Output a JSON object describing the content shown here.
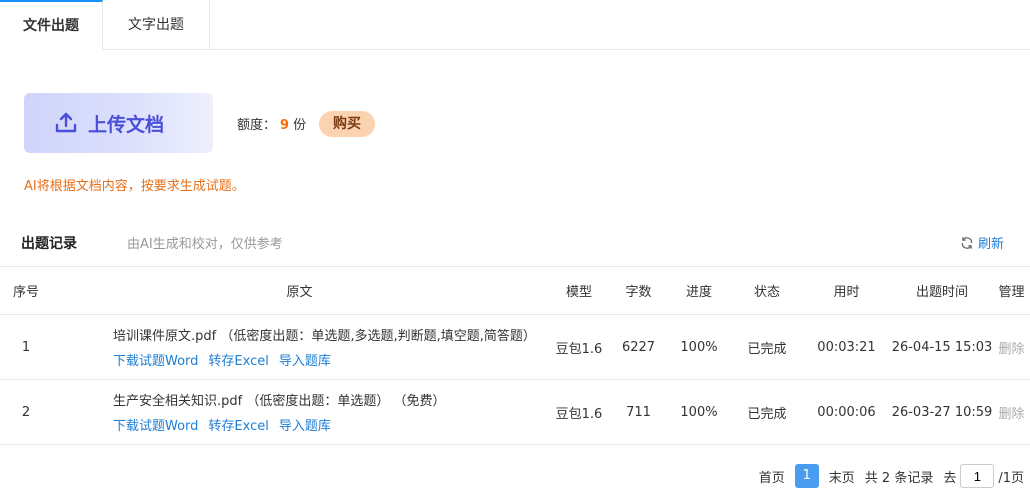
{
  "tabs": [
    {
      "label": "文件出题",
      "active": true
    },
    {
      "label": "文字出题",
      "active": false
    }
  ],
  "upload": {
    "label": "上传文档"
  },
  "quota": {
    "prefix": "额度：",
    "value": "9",
    "unit": "份"
  },
  "buy_label": "购买",
  "hint": "AI将根据文档内容，按要求生成试题。",
  "records": {
    "title": "出题记录",
    "subtitle": "由AI生成和校对，仅供参考",
    "refresh_label": "刷新"
  },
  "table": {
    "headers": [
      "序号",
      "原文",
      "模型",
      "字数",
      "进度",
      "状态",
      "用时",
      "出题时间",
      "管理"
    ],
    "rows": [
      {
        "index": "1",
        "source": "培训课件原文.pdf （低密度出题：单选题,多选题,判断题,填空题,简答题）",
        "links": [
          "下载试题Word",
          "转存Excel",
          "导入题库"
        ],
        "model": "豆包1.6",
        "words": "6227",
        "progress": "100%",
        "status": "已完成",
        "duration": "00:03:21",
        "time": "26-04-15 15:03",
        "action": "删除"
      },
      {
        "index": "2",
        "source": "生产安全相关知识.pdf （低密度出题：单选题） （免费）",
        "links": [
          "下载试题Word",
          "转存Excel",
          "导入题库"
        ],
        "model": "豆包1.6",
        "words": "711",
        "progress": "100%",
        "status": "已完成",
        "duration": "00:00:06",
        "time": "26-03-27 10:59",
        "action": "删除"
      }
    ]
  },
  "pager": {
    "first": "首页",
    "current": "1",
    "last": "末页",
    "total": "共 2 条记录",
    "goto_prefix": "去",
    "goto_value": "1",
    "pages": "/1页"
  },
  "colors": {
    "accent": "#1890ff",
    "orange": "#ff6b00",
    "link": "#1e7ed6"
  }
}
